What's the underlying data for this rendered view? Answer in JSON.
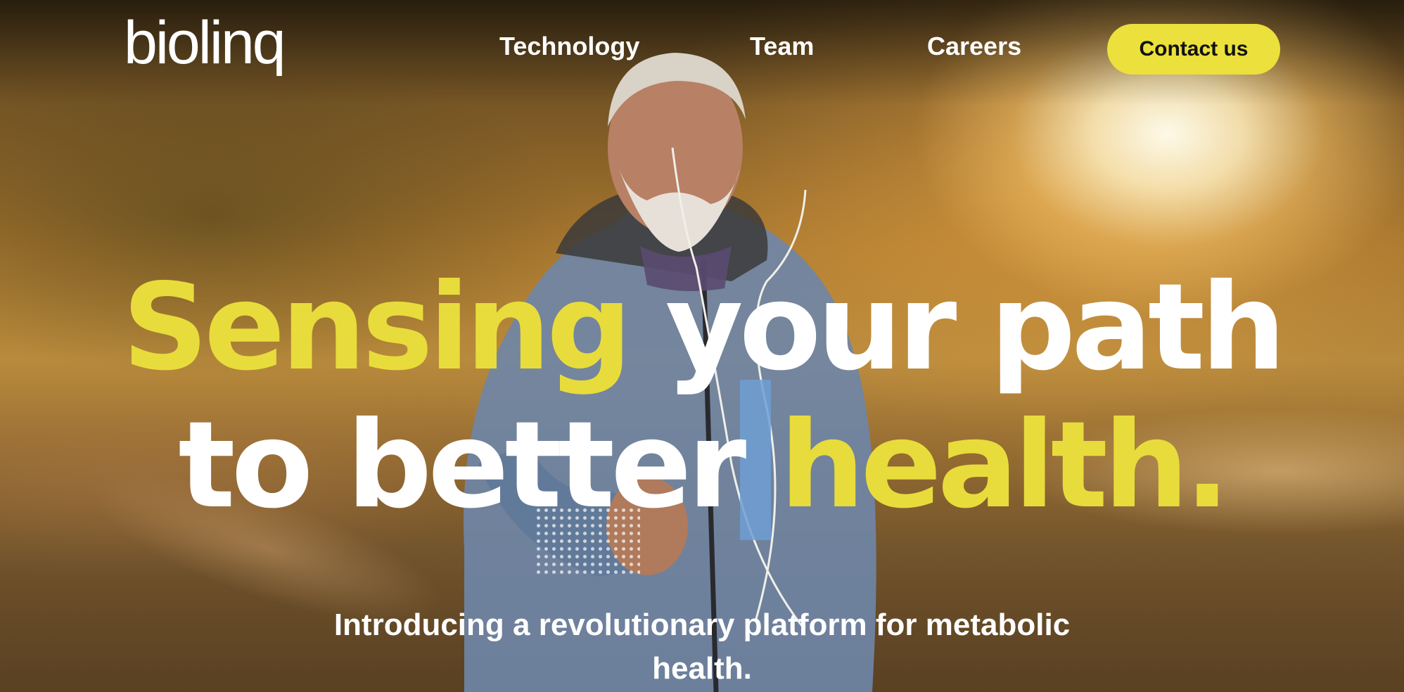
{
  "header": {
    "logo_text": "biolinq",
    "nav": {
      "technology": "Technology",
      "team": "Team",
      "careers": "Careers"
    },
    "contact_label": "Contact us"
  },
  "hero": {
    "headline": {
      "part1": "Sensing",
      "part2": "your path",
      "part3": "to better",
      "part4": "health."
    },
    "subtitle_line1": "Introducing a revolutionary platform for metabolic",
    "subtitle_line2": "health."
  },
  "colors": {
    "accent_yellow": "#e8dc3c",
    "button_yellow": "#ece03c",
    "text_white": "#ffffff",
    "accent_blue": "#6e9fd3"
  },
  "icons": {
    "logo": "biolinq-wordmark",
    "hero_image": "man-running-at-sunrise-photo"
  }
}
